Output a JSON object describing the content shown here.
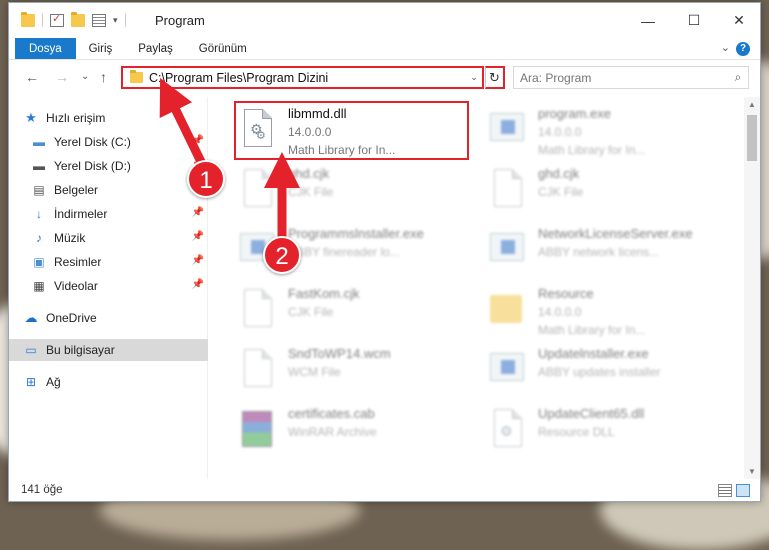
{
  "window": {
    "title": "Program",
    "minimize_glyph": "—",
    "maximize_glyph": "☐",
    "close_glyph": "✕"
  },
  "ribbon": {
    "tabs": [
      {
        "label": "Dosya"
      },
      {
        "label": "Giriş"
      },
      {
        "label": "Paylaş"
      },
      {
        "label": "Görünüm"
      }
    ],
    "collapse_glyph": "⌄",
    "help_glyph": "?"
  },
  "nav": {
    "back_glyph": "←",
    "forward_glyph": "→",
    "recent_glyph": "⌄",
    "up_glyph": "↑",
    "address": "C:\\Program Files\\Program Dizini",
    "address_dropdown_glyph": "⌄",
    "refresh_glyph": "↻",
    "search_placeholder": "Ara: Program",
    "search_glyph": "⌕"
  },
  "sidebar": {
    "items": [
      {
        "label": "Hızlı erişim",
        "icon": "star-icon",
        "pinned": false
      },
      {
        "label": "Yerel Disk (C:)",
        "icon": "drive-icon",
        "pinned": true
      },
      {
        "label": "Yerel Disk (D:)",
        "icon": "drive-icon",
        "pinned": true
      },
      {
        "label": "Belgeler",
        "icon": "documents-icon",
        "pinned": true
      },
      {
        "label": "İndirmeler",
        "icon": "download-icon",
        "pinned": true
      },
      {
        "label": "Müzik",
        "icon": "music-icon",
        "pinned": true
      },
      {
        "label": "Resimler",
        "icon": "pictures-icon",
        "pinned": true
      },
      {
        "label": "Videolar",
        "icon": "videos-icon",
        "pinned": true
      },
      {
        "label": "OneDrive",
        "icon": "cloud-icon",
        "pinned": false
      },
      {
        "label": "Bu bilgisayar",
        "icon": "computer-icon",
        "pinned": false
      },
      {
        "label": "Ağ",
        "icon": "network-icon",
        "pinned": false
      }
    ]
  },
  "files": [
    {
      "name": "libmmd.dll",
      "line2": "14.0.0.0",
      "line3": "Math Library for In...",
      "icon": "dll-file-icon"
    },
    {
      "name": "program.exe",
      "line2": "14.0.0.0",
      "line3": "Math Library for In...",
      "icon": "exe-file-icon"
    },
    {
      "name": "ghd.cjk",
      "line2": "CJK File",
      "line3": "",
      "icon": "generic-file-icon"
    },
    {
      "name": "ghd.cjk",
      "line2": "CJK File",
      "line3": "",
      "icon": "generic-file-icon"
    },
    {
      "name": "Programmslnstaller.exe",
      "line2": "ABBY finereader lo...",
      "line3": "",
      "icon": "exe-file-icon"
    },
    {
      "name": "NetworkLicenseServer.exe",
      "line2": "ABBY network licens...",
      "line3": "",
      "icon": "exe-file-icon"
    },
    {
      "name": "FastKom.cjk",
      "line2": "CJK File",
      "line3": "",
      "icon": "generic-file-icon"
    },
    {
      "name": "Resource",
      "line2": "14.0.0.0",
      "line3": "Math Library for In...",
      "icon": "folder-icon"
    },
    {
      "name": "SndToWP14.wcm",
      "line2": "WCM File",
      "line3": "",
      "icon": "generic-file-icon"
    },
    {
      "name": "Updatelnstaller.exe",
      "line2": "ABBY updates installer",
      "line3": "",
      "icon": "exe-file-icon"
    },
    {
      "name": "certificates.cab",
      "line2": "WinRAR Archive",
      "line3": "",
      "icon": "archive-file-icon"
    },
    {
      "name": "UpdateClient65.dll",
      "line2": "Resource DLL",
      "line3": "",
      "icon": "dll-file-icon"
    }
  ],
  "status": {
    "item_count": "141 öğe"
  },
  "annotations": {
    "step1": "1",
    "step2": "2"
  },
  "colors": {
    "accent": "#1979ca",
    "highlight": "#e3222b"
  }
}
